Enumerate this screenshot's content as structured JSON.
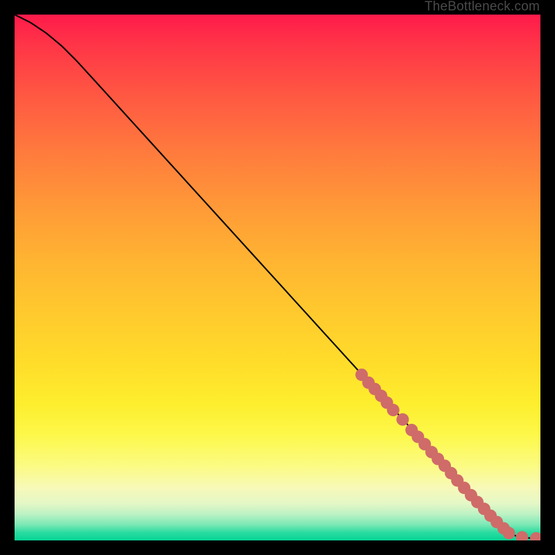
{
  "attribution": "TheBottleneck.com",
  "chart_data": {
    "type": "line",
    "title": "",
    "xlabel": "",
    "ylabel": "",
    "xlim": [
      0,
      100
    ],
    "ylim": [
      0,
      100
    ],
    "grid": false,
    "legend": false,
    "curve": {
      "points": [
        {
          "x": 0,
          "y": 100
        },
        {
          "x": 3,
          "y": 98.5
        },
        {
          "x": 6,
          "y": 96.5
        },
        {
          "x": 9,
          "y": 94
        },
        {
          "x": 12,
          "y": 91
        },
        {
          "x": 67,
          "y": 30.5
        },
        {
          "x": 88,
          "y": 7.5
        },
        {
          "x": 91,
          "y": 4.5
        },
        {
          "x": 93,
          "y": 2.5
        },
        {
          "x": 94.5,
          "y": 1.2
        },
        {
          "x": 96,
          "y": 0.6
        },
        {
          "x": 100,
          "y": 0.3
        }
      ]
    },
    "markers": {
      "color": "#cf6b69",
      "radius_px": 9,
      "points": [
        {
          "x": 66,
          "y": 31.5
        },
        {
          "x": 67.3,
          "y": 30
        },
        {
          "x": 68.5,
          "y": 28.8
        },
        {
          "x": 69.7,
          "y": 27.5
        },
        {
          "x": 70.8,
          "y": 26.2
        },
        {
          "x": 72,
          "y": 24.8
        },
        {
          "x": 73.8,
          "y": 23
        },
        {
          "x": 75.5,
          "y": 21
        },
        {
          "x": 76.7,
          "y": 19.7
        },
        {
          "x": 78,
          "y": 18.3
        },
        {
          "x": 79.3,
          "y": 16.8
        },
        {
          "x": 80.5,
          "y": 15.5
        },
        {
          "x": 81.8,
          "y": 14.2
        },
        {
          "x": 83,
          "y": 12.8
        },
        {
          "x": 84.2,
          "y": 11.4
        },
        {
          "x": 85.5,
          "y": 10
        },
        {
          "x": 86.8,
          "y": 8.6
        },
        {
          "x": 88,
          "y": 7.3
        },
        {
          "x": 89.3,
          "y": 6
        },
        {
          "x": 90.5,
          "y": 4.7
        },
        {
          "x": 91.7,
          "y": 3.5
        },
        {
          "x": 93,
          "y": 2.3
        },
        {
          "x": 94,
          "y": 1.4
        },
        {
          "x": 96.5,
          "y": 0.6
        },
        {
          "x": 99.2,
          "y": 0.4
        }
      ]
    }
  }
}
